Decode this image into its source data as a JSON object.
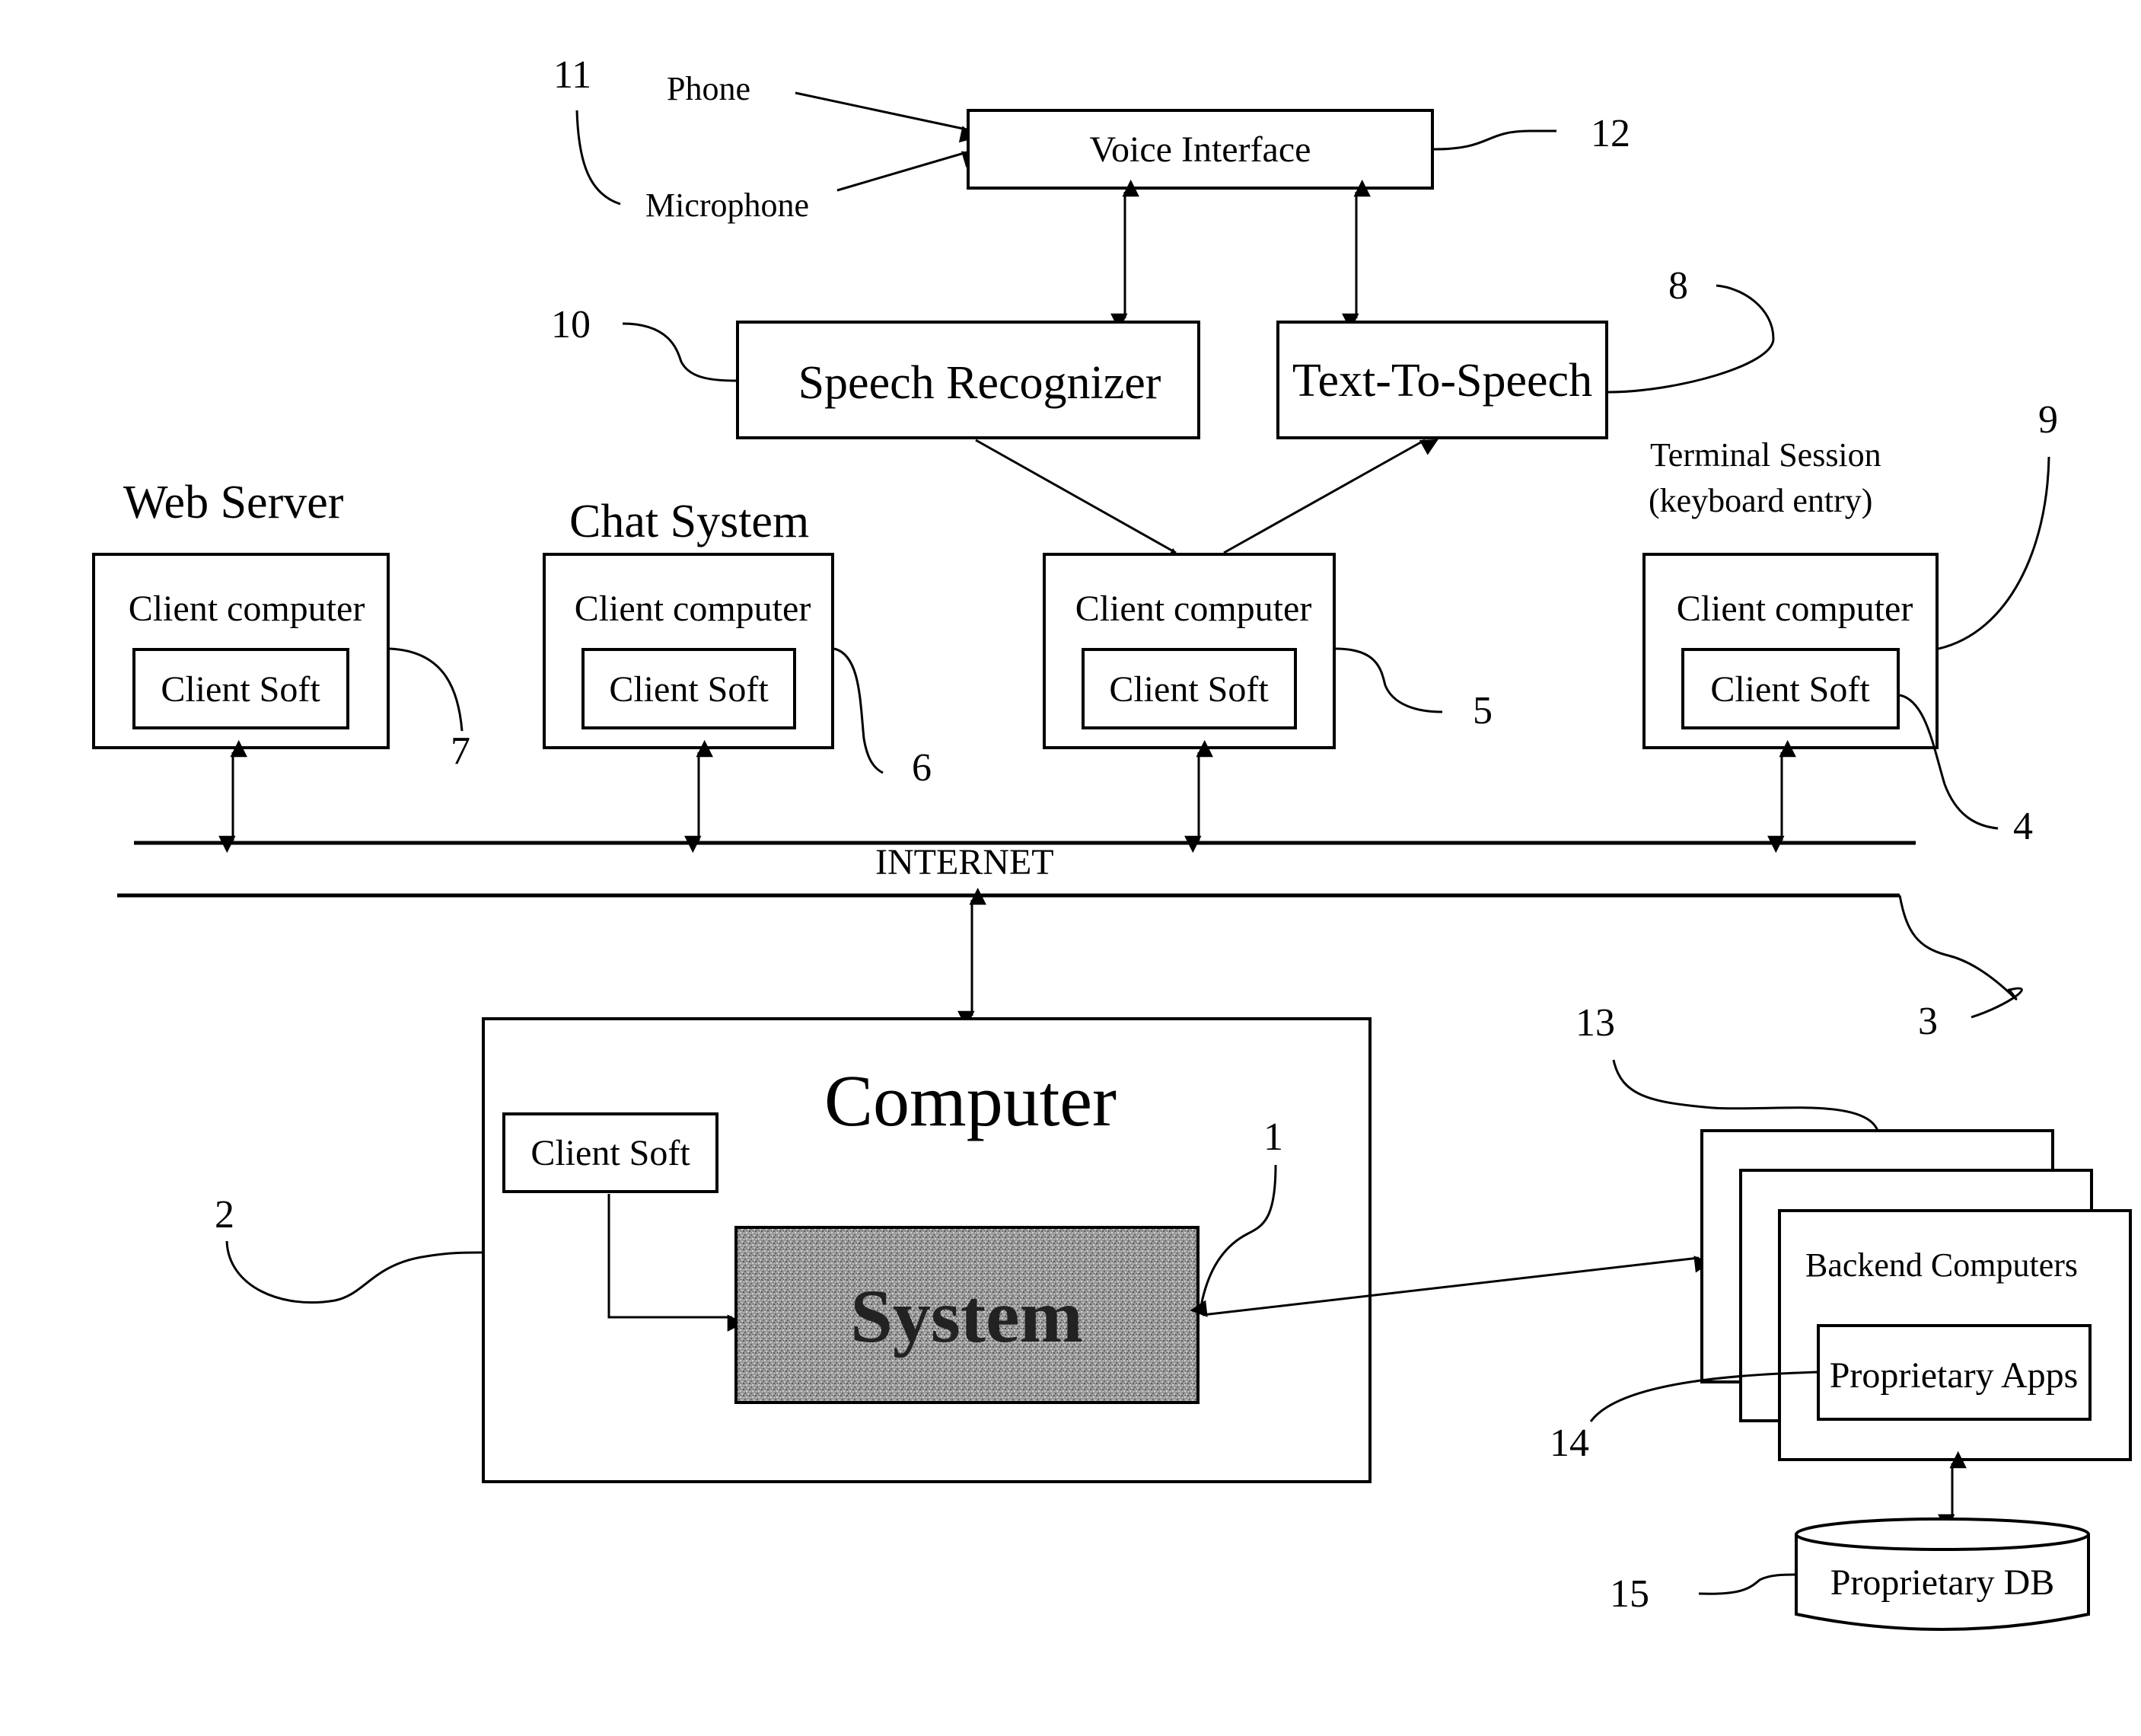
{
  "diagram": {
    "inputs": {
      "phone": "Phone",
      "microphone": "Microphone"
    },
    "voice_interface": "Voice Interface",
    "speech_recognizer": "Speech Recognizer",
    "text_to_speech": "Text-To-Speech",
    "clients": [
      {
        "heading": "Web Server",
        "box_label": "Client computer",
        "inner_label": "Client Soft",
        "ref": "7"
      },
      {
        "heading": "Chat System",
        "box_label": "Client computer",
        "inner_label": "Client Soft",
        "ref": "6"
      },
      {
        "heading": "",
        "box_label": "Client computer",
        "inner_label": "Client Soft",
        "ref": "5"
      },
      {
        "heading_line1": "Terminal Session",
        "heading_line2": "(keyboard entry)",
        "box_label": "Client computer",
        "inner_label": "Client Soft",
        "ref_outer": "9",
        "ref_inner": "4"
      }
    ],
    "network_label": "INTERNET",
    "computer": {
      "title": "Computer",
      "client_soft": "Client Soft",
      "system": "System"
    },
    "backend": {
      "title": "Backend Computers",
      "apps": "Proprietary Apps",
      "db": "Proprietary DB"
    },
    "refs": {
      "system": "1",
      "computer": "2",
      "internet": "3",
      "text_to_speech": "8",
      "speech_recognizer": "10",
      "inputs": "11",
      "voice_interface": "12",
      "backend": "13",
      "apps": "14",
      "db": "15"
    }
  }
}
